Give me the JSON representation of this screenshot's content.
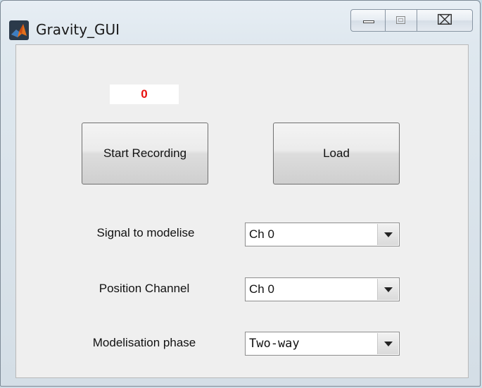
{
  "window": {
    "title": "Gravity_GUI",
    "icon": "matlab-logo-icon",
    "caption_buttons": [
      "minimize-icon",
      "maximize-icon",
      "close-icon"
    ],
    "close_glyph": "⌧"
  },
  "counter": {
    "value": "0",
    "color": "#e8100e"
  },
  "buttons": {
    "start_recording": "Start Recording",
    "load": "Load"
  },
  "fields": [
    {
      "label": "Signal to modelise",
      "value": "Ch 0"
    },
    {
      "label": "Position Channel",
      "value": "Ch 0"
    },
    {
      "label": "Modelisation phase",
      "value": "Two-way"
    }
  ]
}
